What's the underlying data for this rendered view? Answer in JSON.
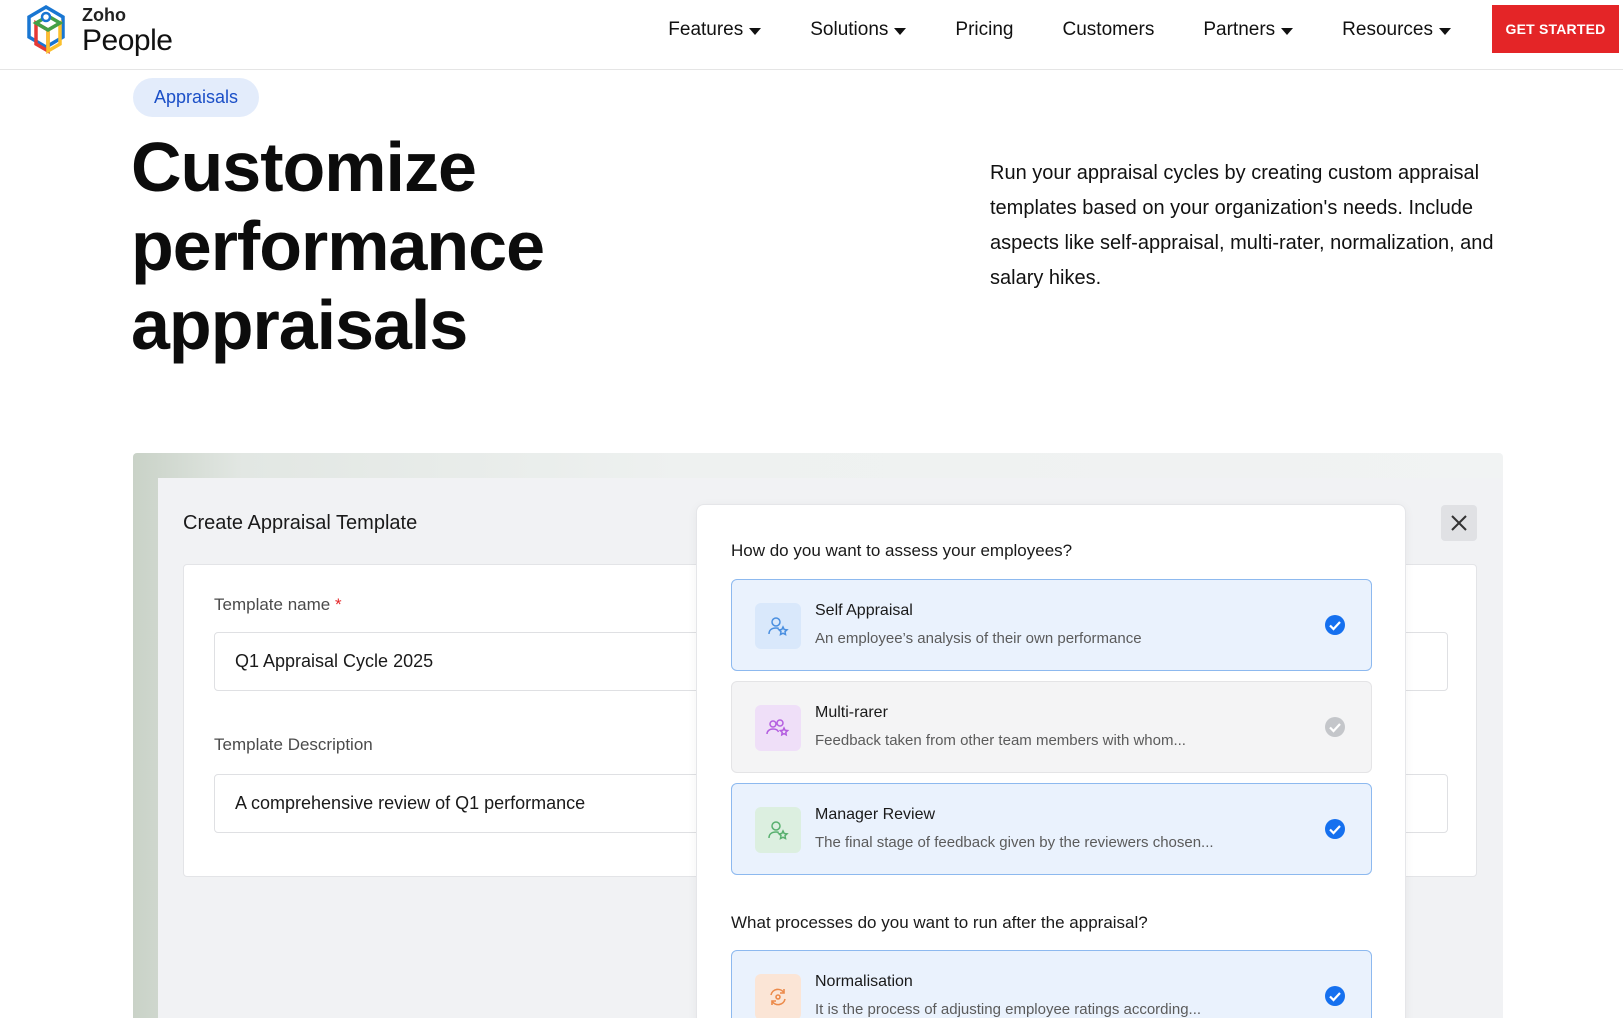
{
  "header": {
    "brand_top": "Zoho",
    "brand_name": "People",
    "nav": [
      {
        "label": "Features",
        "dropdown": true
      },
      {
        "label": "Solutions",
        "dropdown": true
      },
      {
        "label": "Pricing",
        "dropdown": false
      },
      {
        "label": "Customers",
        "dropdown": false
      },
      {
        "label": "Partners",
        "dropdown": true
      },
      {
        "label": "Resources",
        "dropdown": true
      }
    ],
    "cta": "GET STARTED"
  },
  "hero": {
    "tag": "Appraisals",
    "title_lines": [
      "Customize",
      "performance",
      "appraisals"
    ],
    "description": "Run your appraisal cycles by creating custom appraisal templates based on your organization's needs. Include aspects like self-appraisal, multi-rater, normalization, and salary hikes."
  },
  "template_form": {
    "title": "Create Appraisal Template",
    "name_label": "Template name",
    "required_mark": "*",
    "name_value": "Q1 Appraisal Cycle 2025",
    "desc_label": "Template Description",
    "desc_value": "A comprehensive review of Q1 performance"
  },
  "modal": {
    "assess_question": "How do you want to assess your employees?",
    "assess_options": [
      {
        "title": "Self Appraisal",
        "subtitle": "An employee’s analysis of their own performance",
        "selected": true,
        "icon": "user-star-icon",
        "icon_bg": "#d9e8fb",
        "icon_color": "#4a8fe0"
      },
      {
        "title": "Multi-rarer",
        "subtitle": "Feedback taken from other team members with whom...",
        "selected": false,
        "icon": "users-star-icon",
        "icon_bg": "#efdff8",
        "icon_color": "#b45ee0"
      },
      {
        "title": "Manager Review",
        "subtitle": "The final stage of feedback given by the reviewers chosen...",
        "selected": true,
        "icon": "manager-icon",
        "icon_bg": "#dcefe0",
        "icon_color": "#58b06f"
      }
    ],
    "process_question": "What processes do you want to run after the appraisal?",
    "process_options": [
      {
        "title": "Normalisation",
        "subtitle": "It is the process of adjusting employee ratings according...",
        "selected": true,
        "icon": "normalise-icon",
        "icon_bg": "#fbe5d6",
        "icon_color": "#ec8a4a"
      }
    ]
  },
  "colors": {
    "accent": "#e42527",
    "check_selected": "#1570ef",
    "check_unselected": "#c4c6ca"
  }
}
